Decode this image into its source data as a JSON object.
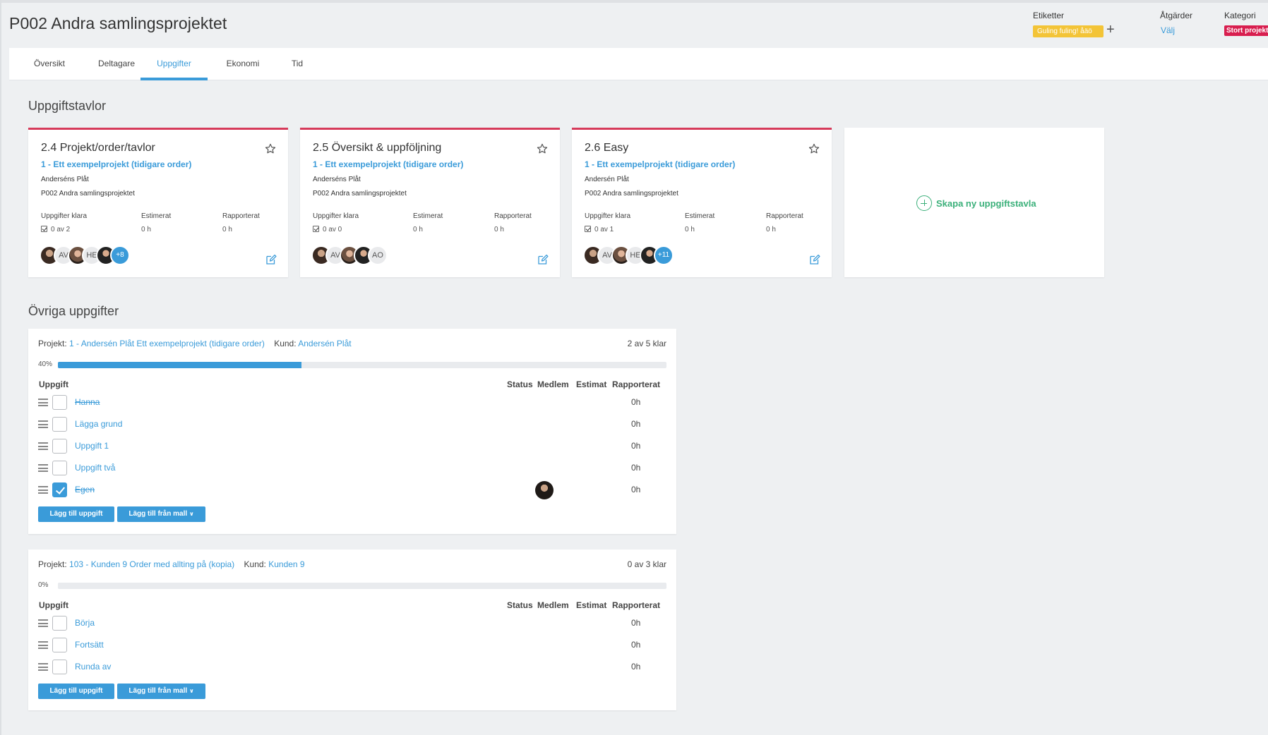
{
  "header": {
    "title": "P002 Andra samlingsprojektet",
    "etiketter_label": "Etiketter",
    "tag": "Guling fuling! åäö",
    "atgarder_label": "Åtgärder",
    "atgarder_value": "Välj",
    "kategori_label": "Kategori",
    "kategori_value": "Stort projekt"
  },
  "tabs": [
    {
      "label": "Översikt"
    },
    {
      "label": "Deltagare"
    },
    {
      "label": "Uppgifter",
      "active": true
    },
    {
      "label": "Ekonomi"
    },
    {
      "label": "Tid"
    }
  ],
  "boards_title": "Uppgiftstavlor",
  "stat_labels": {
    "done": "Uppgifter klara",
    "estimated": "Estimerat",
    "reported": "Rapporterat"
  },
  "boards": [
    {
      "title": "2.4 Projekt/order/tavlor",
      "link": "1 - Ett exempelprojekt (tidigare order)",
      "customer": "Anderséns Plåt",
      "project": "P002 Andra samlingsprojektet",
      "done": "0 av 2",
      "estimated": "0 h",
      "reported": "0 h",
      "avatars": [
        "photo",
        "AV",
        "photo2",
        "HE",
        "photo3"
      ],
      "extra": "+8"
    },
    {
      "title": "2.5 Översikt & uppföljning",
      "link": "1 - Ett exempelprojekt (tidigare order)",
      "customer": "Anderséns Plåt",
      "project": "P002 Andra samlingsprojektet",
      "done": "0 av 0",
      "estimated": "0 h",
      "reported": "0 h",
      "avatars": [
        "photo",
        "AV",
        "photo2",
        "photo3",
        "AO"
      ],
      "extra": ""
    },
    {
      "title": "2.6 Easy",
      "link": "1 - Ett exempelprojekt (tidigare order)",
      "customer": "Andersén Plåt",
      "project": "P002 Andra samlingsprojektet",
      "done": "0 av 1",
      "estimated": "0 h",
      "reported": "0 h",
      "avatars": [
        "photo",
        "AV",
        "photo2",
        "HE",
        "photo3"
      ],
      "extra": "+11"
    }
  ],
  "new_board_label": "Skapa ny uppgiftstavla",
  "other_title": "Övriga uppgifter",
  "columns": {
    "task": "Uppgift",
    "status": "Status",
    "member": "Medlem",
    "estimate": "Estimat",
    "reported": "Rapporterat"
  },
  "buttons": {
    "add_task": "Lägg till uppgift",
    "add_from_template": "Lägg till från mall"
  },
  "panels": [
    {
      "project_prefix": "Projekt:",
      "project_link": "1 - Andersén Plåt Ett exempelprojekt (tidigare order)",
      "customer_prefix": "Kund:",
      "customer_link": "Andersén Plåt",
      "count": "2 av 5 klar",
      "progress_label": "40%",
      "progress": 0.4,
      "tasks": [
        {
          "name": "Hanna",
          "done": true,
          "checked": false,
          "member": false,
          "hours": "0h"
        },
        {
          "name": "Lägga grund",
          "done": false,
          "checked": false,
          "member": false,
          "hours": "0h"
        },
        {
          "name": "Uppgift 1",
          "done": false,
          "checked": false,
          "member": false,
          "hours": "0h"
        },
        {
          "name": "Uppgift två",
          "done": false,
          "checked": false,
          "member": false,
          "hours": "0h"
        },
        {
          "name": "Egen",
          "done": true,
          "checked": true,
          "member": true,
          "hours": "0h"
        }
      ]
    },
    {
      "project_prefix": "Projekt:",
      "project_link": "103 - Kunden 9 Order med allting på (kopia)",
      "customer_prefix": "Kund:",
      "customer_link": "Kunden 9",
      "count": "0 av 3 klar",
      "progress_label": "0%",
      "progress": 0,
      "tasks": [
        {
          "name": "Börja",
          "done": false,
          "checked": false,
          "member": false,
          "hours": "0h"
        },
        {
          "name": "Fortsätt",
          "done": false,
          "checked": false,
          "member": false,
          "hours": "0h"
        },
        {
          "name": "Runda av",
          "done": false,
          "checked": false,
          "member": false,
          "hours": "0h"
        }
      ]
    }
  ]
}
